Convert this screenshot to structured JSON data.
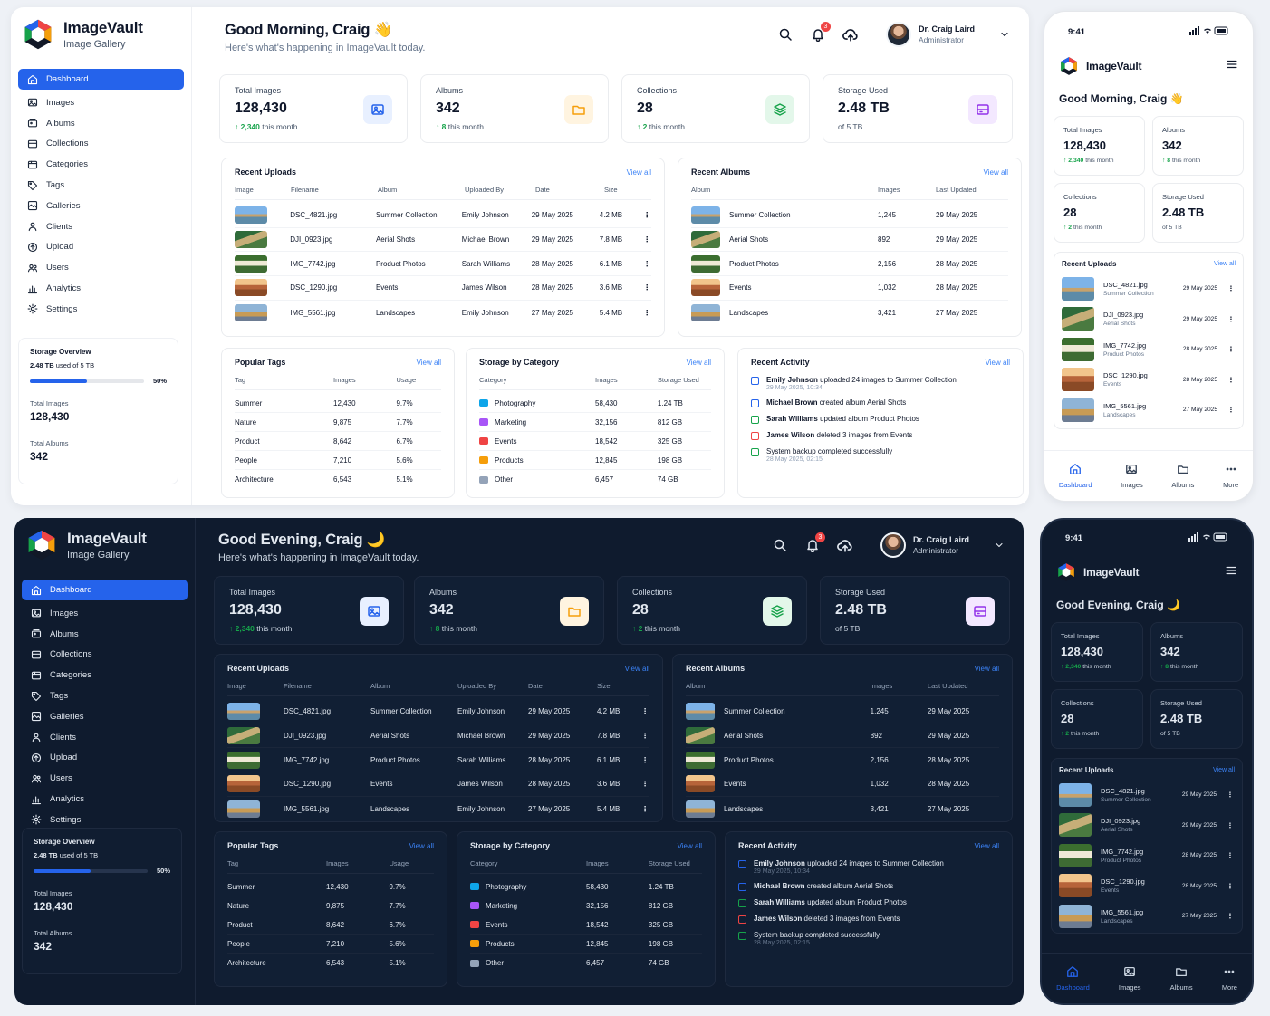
{
  "brand": {
    "name": "ImageVault",
    "subtitle": "Image Gallery"
  },
  "greetings": {
    "light": "Good Morning, Craig 👋",
    "dark": "Good Evening, Craig 🌙",
    "subtitle": "Here's what's happening in ImageVault today."
  },
  "user": {
    "name": "Dr. Craig Laird",
    "role": "Administrator",
    "notifications": "3"
  },
  "nav": [
    "Dashboard",
    "Images",
    "Albums",
    "Collections",
    "Categories",
    "Tags",
    "Galleries",
    "Clients",
    "Upload",
    "Users",
    "Analytics",
    "Settings"
  ],
  "nav_icons": [
    "home-icon",
    "image-icon",
    "album-icon",
    "collection-icon",
    "category-icon",
    "tag-icon",
    "gallery-icon",
    "clients-icon",
    "upload-icon",
    "users-icon",
    "analytics-icon",
    "settings-icon"
  ],
  "storage_overview": {
    "title": "Storage Overview",
    "used_bold": "2.48 TB",
    "used_rest": " used of 5 TB",
    "percent": 50,
    "percent_label": "50%",
    "total_images_label": "Total Images",
    "total_images": "128,430",
    "total_albums_label": "Total Albums",
    "total_albums": "342"
  },
  "stats": [
    {
      "label": "Total Images",
      "value": "128,430",
      "delta": "2,340",
      "delta_suffix": " this month",
      "icon": "image-icon",
      "bg": "#e8f0ff",
      "fg": "#2563eb"
    },
    {
      "label": "Albums",
      "value": "342",
      "delta": "8",
      "delta_suffix": " this month",
      "icon": "folder-icon",
      "bg": "#fff4e0",
      "fg": "#f59e0b"
    },
    {
      "label": "Collections",
      "value": "28",
      "delta": "2",
      "delta_suffix": " this month",
      "icon": "layers-icon",
      "bg": "#e3f7ea",
      "fg": "#16a34a"
    },
    {
      "label": "Storage Used",
      "value": "2.48 TB",
      "note": "of 5 TB",
      "icon": "storage-icon",
      "bg": "#f3e8ff",
      "fg": "#9333ea"
    }
  ],
  "view_all": "View all",
  "recent_uploads": {
    "title": "Recent Uploads",
    "columns": [
      "Image",
      "Filename",
      "Album",
      "Uploaded By",
      "Date",
      "Size"
    ],
    "rows": [
      {
        "file": "DSC_4821.jpg",
        "album": "Summer Collection",
        "by": "Emily Johnson",
        "date": "29 May 2025",
        "size": "4.2 MB"
      },
      {
        "file": "DJI_0923.jpg",
        "album": "Aerial Shots",
        "by": "Michael Brown",
        "date": "29 May 2025",
        "size": "7.8 MB"
      },
      {
        "file": "IMG_7742.jpg",
        "album": "Product Photos",
        "by": "Sarah Williams",
        "date": "28 May 2025",
        "size": "6.1 MB"
      },
      {
        "file": "DSC_1290.jpg",
        "album": "Events",
        "by": "James Wilson",
        "date": "28 May 2025",
        "size": "3.6 MB"
      },
      {
        "file": "IMG_5561.jpg",
        "album": "Landscapes",
        "by": "Emily Johnson",
        "date": "27 May 2025",
        "size": "5.4 MB"
      }
    ]
  },
  "recent_albums": {
    "title": "Recent Albums",
    "columns": [
      "Album",
      "Images",
      "Last Updated"
    ],
    "rows": [
      {
        "name": "Summer Collection",
        "images": "1,245",
        "updated": "29 May 2025"
      },
      {
        "name": "Aerial Shots",
        "images": "892",
        "updated": "29 May 2025"
      },
      {
        "name": "Product Photos",
        "images": "2,156",
        "updated": "28 May 2025"
      },
      {
        "name": "Events",
        "images": "1,032",
        "updated": "28 May 2025"
      },
      {
        "name": "Landscapes",
        "images": "3,421",
        "updated": "27 May 2025"
      }
    ]
  },
  "popular_tags": {
    "title": "Popular Tags",
    "columns": [
      "Tag",
      "Images",
      "Usage"
    ],
    "rows": [
      {
        "tag": "Summer",
        "images": "12,430",
        "usage": "9.7%"
      },
      {
        "tag": "Nature",
        "images": "9,875",
        "usage": "7.7%"
      },
      {
        "tag": "Product",
        "images": "8,642",
        "usage": "6.7%"
      },
      {
        "tag": "People",
        "images": "7,210",
        "usage": "5.6%"
      },
      {
        "tag": "Architecture",
        "images": "6,543",
        "usage": "5.1%"
      }
    ]
  },
  "storage_by_category": {
    "title": "Storage by Category",
    "columns": [
      "Category",
      "Images",
      "Storage Used"
    ],
    "rows": [
      {
        "name": "Photography",
        "images": "58,430",
        "used": "1.24 TB",
        "color": "#0ea5e9"
      },
      {
        "name": "Marketing",
        "images": "32,156",
        "used": "812 GB",
        "color": "#a855f7"
      },
      {
        "name": "Events",
        "images": "18,542",
        "used": "325 GB",
        "color": "#ef4444"
      },
      {
        "name": "Products",
        "images": "12,845",
        "used": "198 GB",
        "color": "#f59e0b"
      },
      {
        "name": "Other",
        "images": "6,457",
        "used": "74 GB",
        "color": "#94a3b8"
      }
    ]
  },
  "recent_activity": {
    "title": "Recent Activity",
    "items": [
      {
        "who": "Emily Johnson",
        "text": " uploaded 24 images to Summer Collection",
        "time": "29 May 2025, 10:34",
        "color": "#2563eb"
      },
      {
        "who": "Michael Brown",
        "text": " created album Aerial Shots",
        "time": "",
        "color": "#2563eb"
      },
      {
        "who": "Sarah Williams",
        "text": " updated album Product Photos",
        "time": "",
        "color": "#16a34a"
      },
      {
        "who": "James Wilson",
        "text": " deleted 3 images from Events",
        "time": "",
        "color": "#ef4444"
      },
      {
        "who": "",
        "text": "System backup completed successfully",
        "time": "28 May 2025, 02:15",
        "color": "#16a34a"
      }
    ]
  },
  "mobile": {
    "time": "9:41",
    "nav": [
      {
        "label": "Dashboard",
        "icon": "home-icon"
      },
      {
        "label": "Images",
        "icon": "image-icon"
      },
      {
        "label": "Albums",
        "icon": "folder-icon"
      },
      {
        "label": "More",
        "icon": "more-icon"
      }
    ]
  }
}
